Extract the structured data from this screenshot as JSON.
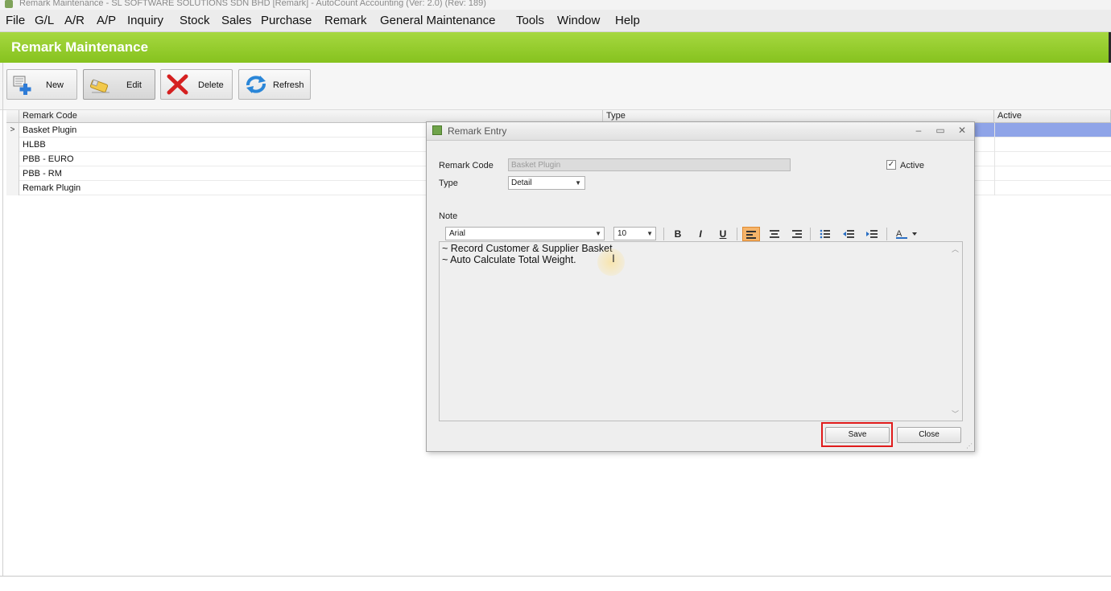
{
  "app": {
    "window_title": "Remark Maintenance - SL SOFTWARE SOLUTIONS SDN BHD [Remark] - AutoCount Accounting (Ver: 2.0) (Rev: 189)"
  },
  "menubar": {
    "items": [
      "File",
      "G/L",
      "A/R",
      "A/P",
      "Inquiry",
      "Stock",
      "Sales",
      "Purchase",
      "Remark",
      "General Maintenance",
      "Tools",
      "Window",
      "Help"
    ]
  },
  "page": {
    "title": "Remark Maintenance"
  },
  "toolbar": {
    "new_label": "New",
    "edit_label": "Edit",
    "delete_label": "Delete",
    "refresh_label": "Refresh"
  },
  "grid": {
    "columns": [
      "Remark Code",
      "Type",
      "Active"
    ],
    "rows": [
      {
        "code": "Basket Plugin",
        "indicator": ">"
      },
      {
        "code": "HLBB",
        "indicator": ""
      },
      {
        "code": "PBB - EURO",
        "indicator": ""
      },
      {
        "code": "PBB - RM",
        "indicator": ""
      },
      {
        "code": "Remark Plugin",
        "indicator": ""
      }
    ]
  },
  "dialog": {
    "title": "Remark Entry",
    "remark_code_label": "Remark Code",
    "remark_code_value": "Basket Plugin",
    "type_label": "Type",
    "type_value": "Detail",
    "active_label": "Active",
    "active_checked": true,
    "note_label": "Note",
    "font_name": "Arial",
    "font_size": "10",
    "note_lines": [
      "~ Record Customer & Supplier Basket",
      "~ Auto Calculate Total Weight."
    ],
    "save_label": "Save",
    "close_label": "Close"
  },
  "colors": {
    "title_green": "#8cc63f",
    "selection_blue": "#8fa4e8",
    "highlight_red": "#e01b1b",
    "align_active": "#f5b46a"
  }
}
